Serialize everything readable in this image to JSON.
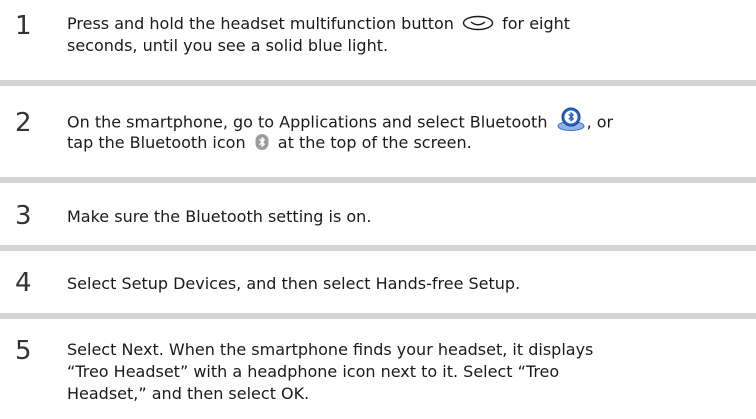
{
  "colors": {
    "divider": "#d4d4d4",
    "text": "#1a1a1a",
    "number": "#333333",
    "bluetooth_blue": "#1f5fc4"
  },
  "steps": [
    {
      "number": "1",
      "line1_a": "Press and hold the headset multifunction button",
      "icon": "multifunction-button-icon",
      "line1_b": "for eight",
      "line2": "seconds, until you see a solid blue light."
    },
    {
      "number": "2",
      "line1_a": "On the smartphone, go to Applications and select Bluetooth",
      "icon1": "bluetooth-app-icon",
      "line1_b": ", or",
      "line2_a": "tap the Bluetooth icon",
      "icon2": "bluetooth-status-icon",
      "line2_b": "at the top of the screen."
    },
    {
      "number": "3",
      "line1": "Make sure the Bluetooth setting is on."
    },
    {
      "number": "4",
      "line1": "Select Setup Devices, and then select Hands-free Setup."
    },
    {
      "number": "5",
      "line1": "Select Next. When the smartphone finds your headset, it displays",
      "line2": "“Treo Headset” with a headphone icon next to it. Select “Treo",
      "line3": "Headset,” and then select OK."
    }
  ]
}
